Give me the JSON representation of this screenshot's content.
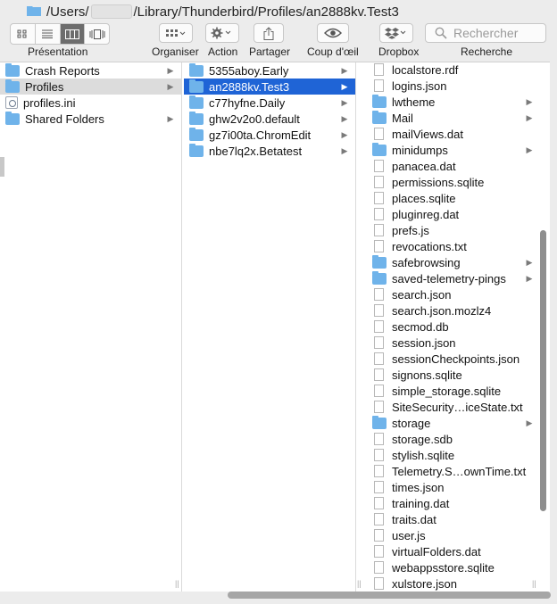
{
  "path": {
    "prefix": "/Users/",
    "suffix": "/Library/Thunderbird/Profiles/an2888kv.Test3"
  },
  "toolbar": {
    "view_label": "Présentation",
    "organize_label": "Organiser",
    "action_label": "Action",
    "share_label": "Partager",
    "quicklook_label": "Coup d'œil",
    "dropbox_label": "Dropbox",
    "search_label": "Recherche",
    "search_placeholder": "Rechercher"
  },
  "columns": {
    "col1": [
      {
        "name": "Crash Reports",
        "kind": "folder",
        "arrow": true,
        "state": ""
      },
      {
        "name": "Profiles",
        "kind": "folder",
        "arrow": true,
        "state": "gray"
      },
      {
        "name": "profiles.ini",
        "kind": "ini",
        "arrow": false,
        "state": ""
      },
      {
        "name": "Shared Folders",
        "kind": "folder",
        "arrow": true,
        "state": ""
      }
    ],
    "col2": [
      {
        "name": "5355aboy.Early",
        "kind": "folder",
        "arrow": true,
        "state": ""
      },
      {
        "name": "an2888kv.Test3",
        "kind": "folder",
        "arrow": true,
        "state": "blue"
      },
      {
        "name": "c77hyfne.Daily",
        "kind": "folder",
        "arrow": true,
        "state": ""
      },
      {
        "name": "ghw2v2o0.default",
        "kind": "folder",
        "arrow": true,
        "state": ""
      },
      {
        "name": "gz7i00ta.ChromEdit",
        "kind": "folder",
        "arrow": true,
        "state": ""
      },
      {
        "name": "nbe7lq2x.Betatest",
        "kind": "folder",
        "arrow": true,
        "state": ""
      }
    ],
    "col3": [
      {
        "name": "localstore.rdf",
        "kind": "file",
        "arrow": false
      },
      {
        "name": "logins.json",
        "kind": "file",
        "arrow": false
      },
      {
        "name": "lwtheme",
        "kind": "folder",
        "arrow": true
      },
      {
        "name": "Mail",
        "kind": "folder",
        "arrow": true
      },
      {
        "name": "mailViews.dat",
        "kind": "file",
        "arrow": false
      },
      {
        "name": "minidumps",
        "kind": "folder",
        "arrow": true
      },
      {
        "name": "panacea.dat",
        "kind": "file",
        "arrow": false
      },
      {
        "name": "permissions.sqlite",
        "kind": "file",
        "arrow": false
      },
      {
        "name": "places.sqlite",
        "kind": "file",
        "arrow": false
      },
      {
        "name": "pluginreg.dat",
        "kind": "file",
        "arrow": false
      },
      {
        "name": "prefs.js",
        "kind": "file",
        "arrow": false
      },
      {
        "name": "revocations.txt",
        "kind": "file",
        "arrow": false
      },
      {
        "name": "safebrowsing",
        "kind": "folder",
        "arrow": true
      },
      {
        "name": "saved-telemetry-pings",
        "kind": "folder",
        "arrow": true
      },
      {
        "name": "search.json",
        "kind": "file",
        "arrow": false
      },
      {
        "name": "search.json.mozlz4",
        "kind": "file",
        "arrow": false
      },
      {
        "name": "secmod.db",
        "kind": "file",
        "arrow": false
      },
      {
        "name": "session.json",
        "kind": "file",
        "arrow": false
      },
      {
        "name": "sessionCheckpoints.json",
        "kind": "file",
        "arrow": false
      },
      {
        "name": "signons.sqlite",
        "kind": "file",
        "arrow": false
      },
      {
        "name": "simple_storage.sqlite",
        "kind": "file",
        "arrow": false
      },
      {
        "name": "SiteSecurity…iceState.txt",
        "kind": "file",
        "arrow": false
      },
      {
        "name": "storage",
        "kind": "folder",
        "arrow": true
      },
      {
        "name": "storage.sdb",
        "kind": "file",
        "arrow": false
      },
      {
        "name": "stylish.sqlite",
        "kind": "file",
        "arrow": false
      },
      {
        "name": "Telemetry.S…ownTime.txt",
        "kind": "file",
        "arrow": false
      },
      {
        "name": "times.json",
        "kind": "file",
        "arrow": false
      },
      {
        "name": "training.dat",
        "kind": "file",
        "arrow": false
      },
      {
        "name": "traits.dat",
        "kind": "file",
        "arrow": false
      },
      {
        "name": "user.js",
        "kind": "file",
        "arrow": false
      },
      {
        "name": "virtualFolders.dat",
        "kind": "file",
        "arrow": false
      },
      {
        "name": "webappsstore.sqlite",
        "kind": "file",
        "arrow": false
      },
      {
        "name": "xulstore.json",
        "kind": "file",
        "arrow": false
      }
    ]
  },
  "colors": {
    "selection_blue": "#1f64d6",
    "selection_gray": "#dcdcdc",
    "folder_blue": "#6fb3ea"
  }
}
